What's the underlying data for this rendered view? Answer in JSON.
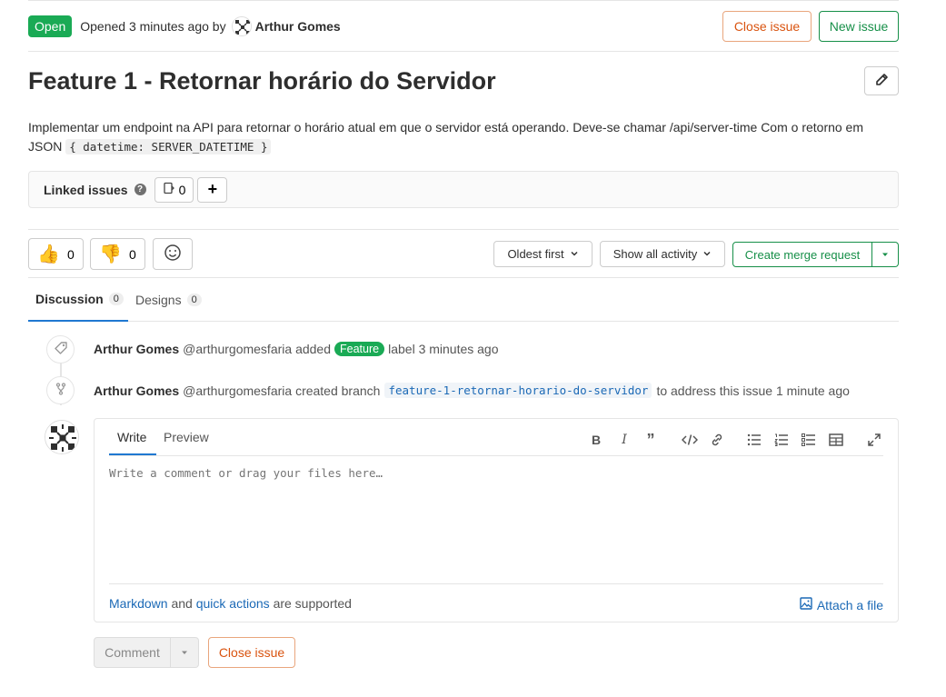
{
  "header": {
    "status": "Open",
    "opened_text": "Opened 3 minutes ago by",
    "author": "Arthur Gomes",
    "close_button": "Close issue",
    "new_button": "New issue"
  },
  "issue": {
    "title": "Feature 1 - Retornar horário do Servidor",
    "description_text": "Implementar um endpoint na API para retornar o horário atual em que o servidor está operando. Deve-se chamar /api/server-time Com o retorno em JSON",
    "description_code": "{ datetime: SERVER_DATETIME }"
  },
  "linked_issues": {
    "label": "Linked issues",
    "count": "0",
    "add_symbol": "+"
  },
  "reactions": {
    "thumbs_up_count": "0",
    "thumbs_down_count": "0"
  },
  "controls": {
    "sort": "Oldest first",
    "filter": "Show all activity",
    "merge_request": "Create merge request"
  },
  "tabs": [
    {
      "label": "Discussion",
      "count": "0"
    },
    {
      "label": "Designs",
      "count": "0"
    }
  ],
  "timeline": [
    {
      "author": "Arthur Gomes",
      "handle": "@arthurgomesfaria",
      "action": "added",
      "label": "Feature",
      "suffix": "label 3 minutes ago"
    },
    {
      "author": "Arthur Gomes",
      "handle": "@arthurgomesfaria",
      "action": "created branch",
      "branch": "feature-1-retornar-horario-do-servidor",
      "suffix": "to address this issue 1 minute ago"
    }
  ],
  "editor": {
    "tab_write": "Write",
    "tab_preview": "Preview",
    "placeholder": "Write a comment or drag your files here…",
    "footer_markdown": "Markdown",
    "footer_and": "and",
    "footer_quick_actions": "quick actions",
    "footer_supported": "are supported",
    "attach": "Attach a file"
  },
  "actions": {
    "comment": "Comment",
    "close": "Close issue"
  },
  "colors": {
    "green": "#1aaa55",
    "blue": "#1f78d1",
    "orange": "#d9530f"
  }
}
